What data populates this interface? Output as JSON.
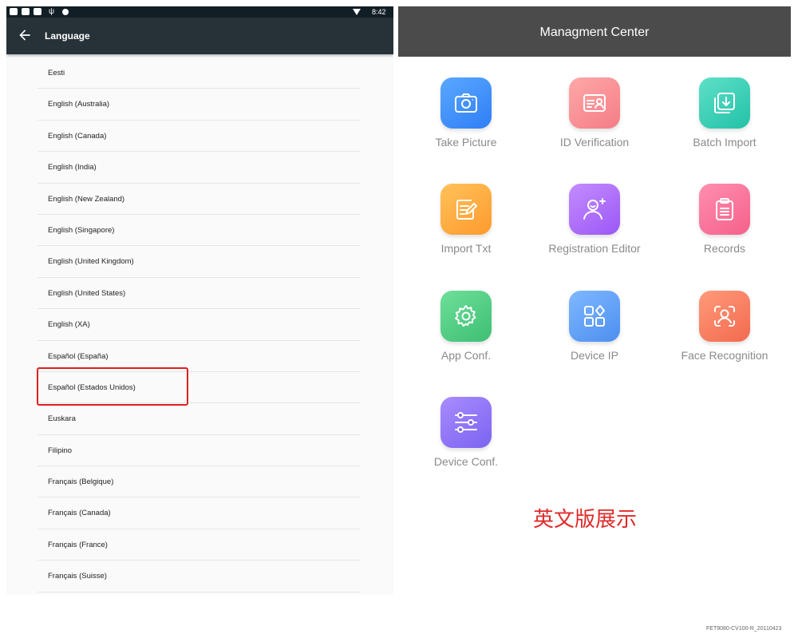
{
  "status_bar": {
    "time": "8:42",
    "usb_glyph": "ψ"
  },
  "app_bar": {
    "title": "Language",
    "back_icon": "arrow-left-icon"
  },
  "languages": [
    {
      "label": "Eesti"
    },
    {
      "label": "English (Australia)"
    },
    {
      "label": "English (Canada)"
    },
    {
      "label": "English (India)"
    },
    {
      "label": "English (New Zealand)"
    },
    {
      "label": "English (Singapore)"
    },
    {
      "label": "English (United Kingdom)"
    },
    {
      "label": "English (United States)"
    },
    {
      "label": "English (XA)"
    },
    {
      "label": "Español (España)"
    },
    {
      "label": "Español (Estados Unidos)"
    },
    {
      "label": "Euskara"
    },
    {
      "label": "Filipino"
    },
    {
      "label": "Français (Belgique)"
    },
    {
      "label": "Français (Canada)"
    },
    {
      "label": "Français (France)"
    },
    {
      "label": "Français (Suisse)"
    }
  ],
  "highlight_color": "#e02020",
  "mgmt": {
    "title": "Managment Center",
    "tiles": [
      {
        "label": "Take Picture",
        "icon": "camera-icon",
        "color_from": "#5aa8ff",
        "color_to": "#2f7ef6"
      },
      {
        "label": "ID Verification",
        "icon": "id-card-icon",
        "color_from": "#ffa8a8",
        "color_to": "#f47d86"
      },
      {
        "label": "Batch Import",
        "icon": "batch-import-icon",
        "color_from": "#5fe0c8",
        "color_to": "#22c1a8"
      },
      {
        "label": "Import Txt",
        "icon": "edit-document-icon",
        "color_from": "#ffc25a",
        "color_to": "#ff9a2e"
      },
      {
        "label": "Registration Editor",
        "icon": "user-add-icon",
        "color_from": "#c48cff",
        "color_to": "#9b57f5"
      },
      {
        "label": "Records",
        "icon": "clipboard-icon",
        "color_from": "#ff8fb0",
        "color_to": "#f5608a"
      },
      {
        "label": "App Conf.",
        "icon": "gear-icon",
        "color_from": "#6fdf9a",
        "color_to": "#3dbf73"
      },
      {
        "label": "Device IP",
        "icon": "grid-icon",
        "color_from": "#7fb8ff",
        "color_to": "#4d8ff0"
      },
      {
        "label": "Face Recognition",
        "icon": "face-scan-icon",
        "color_from": "#ff9a7a",
        "color_to": "#f36a4f"
      },
      {
        "label": "Device Conf.",
        "icon": "sliders-icon",
        "color_from": "#a88cff",
        "color_to": "#7b63f0"
      }
    ]
  },
  "caption": "英文版展示",
  "footer_code": "FET9080-CV100-R_20110423"
}
